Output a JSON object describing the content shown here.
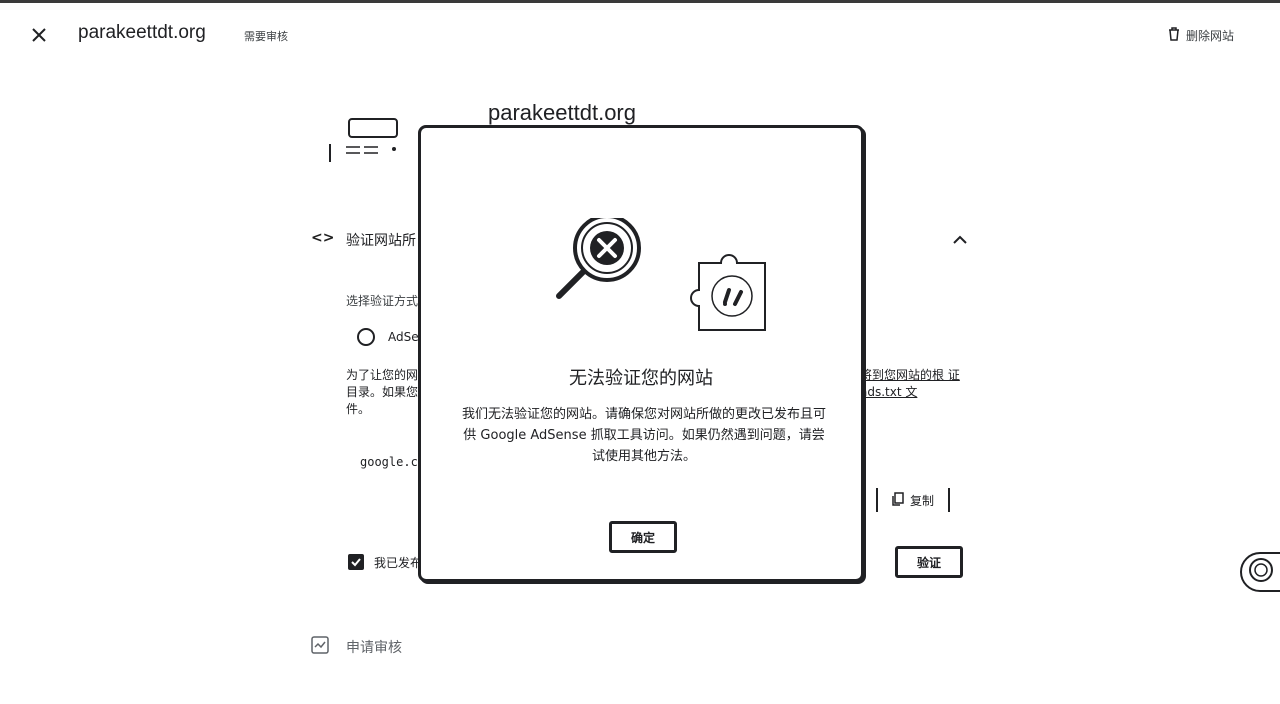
{
  "header": {
    "site_name": "parakeettdt.org",
    "status": "需要审核",
    "delete_label": "删除网站"
  },
  "background": {
    "site_title": "parakeettdt.org",
    "section_title": "验证网站所",
    "method_label": "选择验证方式",
    "radio_label": "AdSe",
    "para_left": "为了让您的网 目录。如果您 件。",
    "para_right": "将到您网站的根 证 ads.txt 文",
    "code_snippet": "google.c",
    "copy_label": "复制",
    "checkbox_label": "我已发布",
    "verify_label": "验证",
    "review_label": "申请审核"
  },
  "dialog": {
    "title": "无法验证您的网站",
    "body": "我们无法验证您的网站。请确保您对网站所做的更改已发布且可供 Google AdSense 抓取工具访问。如果仍然遇到问题，请尝试使用其他方法。",
    "ok_label": "确定"
  },
  "icons": {
    "close": "close-icon",
    "delete": "trash-icon",
    "code": "code-icon",
    "chevron": "chevron-up-icon",
    "copy": "copy-icon",
    "review": "review-icon",
    "help": "help-icon",
    "search_error": "magnifier-error-icon",
    "puzzle": "puzzle-piece-icon"
  }
}
